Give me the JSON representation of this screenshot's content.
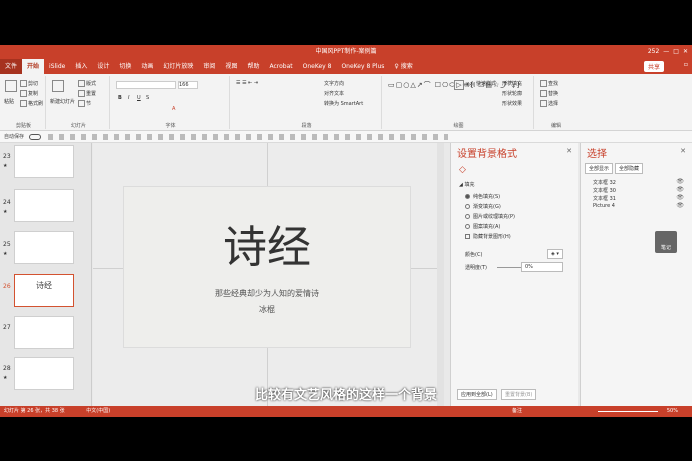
{
  "window_title": "中国风PPT制作-案例篇",
  "titlebar_right": "252",
  "tabs": [
    "文件",
    "开始",
    "iSlide",
    "插入",
    "设计",
    "切换",
    "动画",
    "幻灯片放映",
    "审阅",
    "视图",
    "帮助",
    "Acrobat",
    "OneKey 8",
    "OneKey 8 Plus",
    "♀ 搜索"
  ],
  "share": "共享",
  "comment": "▫",
  "ribbon": {
    "clipboard": {
      "label": "剪贴板",
      "paste": "粘贴",
      "cut": "剪切",
      "copy": "复制",
      "format": "格式刷"
    },
    "slides": {
      "label": "幻灯片",
      "new": "新建幻灯片",
      "layout": "版式",
      "reset": "重置",
      "section": "节"
    },
    "font": {
      "label": "字体",
      "size": "166"
    },
    "paragraph": {
      "label": "段落",
      "text_dir": "文字方向",
      "align": "对齐文本",
      "smartart": "转换为 SmartArt"
    },
    "drawing": {
      "label": "绘图",
      "arrange": "排列",
      "styles": "快速样式",
      "fill": "形状填充",
      "outline": "形状轮廓",
      "effect": "形状效果"
    },
    "editing": {
      "label": "编辑",
      "find": "查找",
      "replace": "替换",
      "select": "选择"
    }
  },
  "qat": {
    "autosave": "自动保存"
  },
  "thumbnails": [
    {
      "num": "23",
      "star": "★"
    },
    {
      "num": "24",
      "star": "★"
    },
    {
      "num": "25",
      "star": "★"
    },
    {
      "num": "26",
      "title": "诗经"
    },
    {
      "num": "27"
    },
    {
      "num": "28",
      "star": "★"
    }
  ],
  "slide": {
    "title": "诗经",
    "subtitle": "那些经典却少为人知的爱情诗",
    "author": "冰棍"
  },
  "bg_pane": {
    "title": "设置背景格式",
    "section": "填充",
    "options": [
      "纯色填充(S)",
      "渐变填充(G)",
      "图片或纹理填充(P)",
      "图案填充(A)",
      "隐藏背景图形(H)"
    ],
    "color_label": "颜色(C)",
    "transparency_label": "透明度(T)",
    "transparency_value": "0%",
    "apply_all": "应用到全部(L)",
    "reset": "重置背景(B)"
  },
  "selection_pane": {
    "title": "选择",
    "show_all": "全部显示",
    "hide_all": "全部隐藏",
    "items": [
      "文本框 32",
      "文本框 30",
      "文本框 31",
      "Picture 4"
    ]
  },
  "status": {
    "slide_info": "幻灯片 第 26 张，共 38 张",
    "lang": "中文(中国)",
    "notes": "备注",
    "zoom": "50%"
  },
  "notes_badge": "笔记",
  "subtitle": "比较有文艺风格的这样一个背景"
}
